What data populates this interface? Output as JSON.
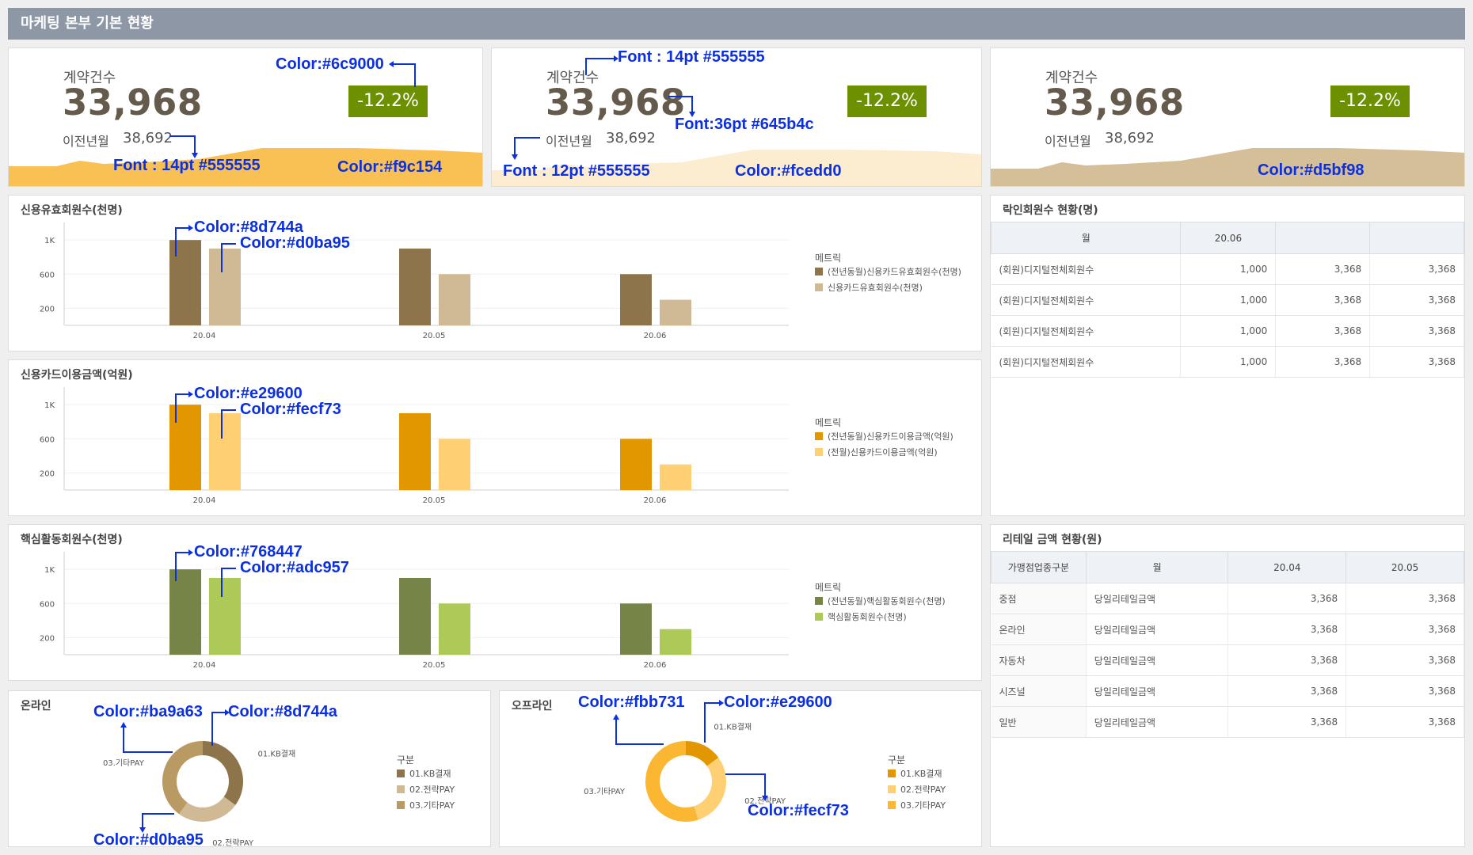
{
  "header": {
    "title": "마케팅 본부 기본 현황"
  },
  "kpis": [
    {
      "label": "계약건수",
      "value": "33,968",
      "prev_label": "이전년월",
      "prev_value": "38,692",
      "change": "-12.2%",
      "fill_color": "#f9c154"
    },
    {
      "label": "계약건수",
      "value": "33,968",
      "prev_label": "이전년월",
      "prev_value": "38,692",
      "change": "-12.2%",
      "fill_color": "#fcedd0"
    },
    {
      "label": "계약건수",
      "value": "33,968",
      "prev_label": "이전년월",
      "prev_value": "38,692",
      "change": "-12.2%",
      "fill_color": "#d5bf98"
    }
  ],
  "bar_charts": [
    {
      "title": "신용유효회원수(천명)",
      "legend_title": "메트릭",
      "series": [
        {
          "name": "(전년동월)신용카드유효회원수(천명)",
          "color": "#8d744a"
        },
        {
          "name": "신용카드유효회원수(천명)",
          "color": "#d0ba95"
        }
      ],
      "annotations": [
        "Color:#8d744a",
        "Color:#d0ba95"
      ]
    },
    {
      "title": "신용카드이용금액(억원)",
      "legend_title": "메트릭",
      "series": [
        {
          "name": "(전년동월)신용카드이용금액(억원)",
          "color": "#e29600"
        },
        {
          "name": "(전월)신용카드이용금액(억원)",
          "color": "#fecf73"
        }
      ],
      "annotations": [
        "Color:#e29600",
        "Color:#fecf73"
      ]
    },
    {
      "title": "핵심활동회원수(천명)",
      "legend_title": "메트릭",
      "series": [
        {
          "name": "(전년동월)핵심활동회원수(천명)",
          "color": "#768447"
        },
        {
          "name": "핵심활동회원수(천명)",
          "color": "#adc957"
        }
      ],
      "annotations": [
        "Color:#768447",
        "Color:#adc957"
      ]
    }
  ],
  "chart_data": [
    {
      "type": "bar",
      "categories": [
        "20.04",
        "20.05",
        "20.06"
      ],
      "yticks": [
        "1K",
        "600",
        "200"
      ],
      "tick_values": [
        1000,
        600,
        200
      ],
      "ylim": [
        0,
        1150
      ],
      "series": [
        {
          "name": "(전년동월)신용카드유효회원수(천명)",
          "values": [
            1000,
            900,
            600
          ]
        },
        {
          "name": "신용카드유효회원수(천명)",
          "values": [
            900,
            600,
            300
          ]
        }
      ]
    },
    {
      "type": "bar",
      "categories": [
        "20.04",
        "20.05",
        "20.06"
      ],
      "yticks": [
        "1K",
        "600",
        "200"
      ],
      "tick_values": [
        1000,
        600,
        200
      ],
      "ylim": [
        0,
        1150
      ],
      "series": [
        {
          "name": "(전년동월)신용카드이용금액(억원)",
          "values": [
            1000,
            900,
            600
          ]
        },
        {
          "name": "(전월)신용카드이용금액(억원)",
          "values": [
            900,
            600,
            300
          ]
        }
      ]
    },
    {
      "type": "bar",
      "categories": [
        "20.04",
        "20.05",
        "20.06"
      ],
      "yticks": [
        "1K",
        "600",
        "200"
      ],
      "tick_values": [
        1000,
        600,
        200
      ],
      "ylim": [
        0,
        1150
      ],
      "series": [
        {
          "name": "(전년동월)핵심활동회원수(천명)",
          "values": [
            1000,
            900,
            600
          ]
        },
        {
          "name": "핵심활동회원수(천명)",
          "values": [
            900,
            600,
            300
          ]
        }
      ]
    },
    {
      "type": "pie",
      "title": "온라인",
      "legend_title": "구분",
      "categories": [
        "01.KB결재",
        "02.전략PAY",
        "03.기타PAY"
      ],
      "values": [
        35,
        25,
        40
      ],
      "colors": [
        "#8d744a",
        "#d0ba95",
        "#ba9a63"
      ]
    },
    {
      "type": "pie",
      "title": "오프라인",
      "legend_title": "구분",
      "categories": [
        "01.KB결재",
        "02.전략PAY",
        "03.기타PAY"
      ],
      "values": [
        15,
        30,
        55
      ],
      "colors": [
        "#e29600",
        "#fecf73",
        "#fbb731"
      ]
    }
  ],
  "tables": {
    "members": {
      "title": "락인회원수 현황(명)",
      "headers": [
        "월",
        "20.06",
        "",
        ""
      ],
      "rows": [
        [
          "(회원)디지털전체회원수",
          "1,000",
          "3,368",
          "3,368"
        ],
        [
          "(회원)디지털전체회원수",
          "1,000",
          "3,368",
          "3,368"
        ],
        [
          "(회원)디지털전체회원수",
          "1,000",
          "3,368",
          "3,368"
        ],
        [
          "(회원)디지털전체회원수",
          "1,000",
          "3,368",
          "3,368"
        ]
      ]
    },
    "retail": {
      "title": "리테일 금액 현황(원)",
      "headers": [
        "가맹점업종구분",
        "월",
        "20.04",
        "20.05"
      ],
      "rows": [
        [
          "중점",
          "당일리테일금액",
          "3,368",
          "3,368"
        ],
        [
          "온라인",
          "당일리테일금액",
          "3,368",
          "3,368"
        ],
        [
          "자동차",
          "당일리테일금액",
          "3,368",
          "3,368"
        ],
        [
          "시즈널",
          "당일리테일금액",
          "3,368",
          "3,368"
        ],
        [
          "일반",
          "당일리테일금액",
          "3,368",
          "3,368"
        ]
      ]
    }
  },
  "kpi_annotations": {
    "k1_badge": "Color:#6c9000",
    "k1_font": "Font : 14pt #555555",
    "k1_fill": "Color:#f9c154",
    "k2_label_font": "Font : 14pt #555555",
    "k2_value_font": "Font:36pt #645b4c",
    "k2_prev_font": "Font : 12pt #555555",
    "k2_fill": "Color:#fcedd0",
    "k3_fill": "Color:#d5bf98"
  },
  "donut_annotations": {
    "online": [
      "Color:#ba9a63",
      "Color:#8d744a",
      "Color:#d0ba95"
    ],
    "offline": [
      "Color:#fbb731",
      "Color:#e29600",
      "Color:#fecf73"
    ]
  }
}
